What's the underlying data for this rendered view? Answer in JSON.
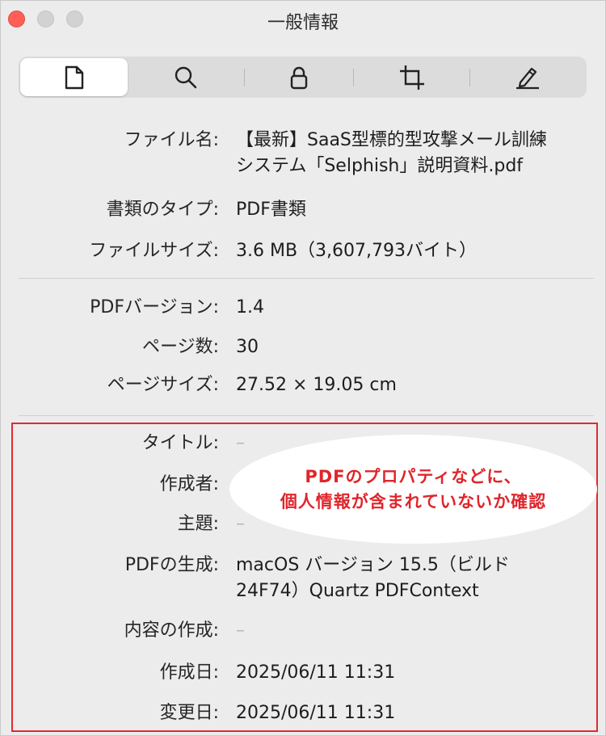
{
  "window": {
    "title": "一般情報"
  },
  "toolbar": {
    "tabs": [
      {
        "name": "document",
        "icon": "document-icon",
        "selected": true
      },
      {
        "name": "search",
        "icon": "search-icon",
        "selected": false
      },
      {
        "name": "security",
        "icon": "lock-icon",
        "selected": false
      },
      {
        "name": "crop",
        "icon": "crop-icon",
        "selected": false
      },
      {
        "name": "annotate",
        "icon": "pencil-icon",
        "selected": false
      }
    ]
  },
  "info": {
    "file_name_label": "ファイル名:",
    "file_name_line1": "【最新】SaaS型標的型攻撃メール訓練",
    "file_name_line2": "システム「Selphish」説明資料.pdf",
    "doc_type_label": "書類のタイプ:",
    "doc_type_value": "PDF書類",
    "file_size_label": "ファイルサイズ:",
    "file_size_value": "3.6 MB（3,607,793バイト）",
    "pdf_version_label": "PDFバージョン:",
    "pdf_version_value": "1.4",
    "page_count_label": "ページ数:",
    "page_count_value": "30",
    "page_size_label": "ページサイズ:",
    "page_size_value": "27.52 × 19.05 cm",
    "title_label": "タイトル:",
    "title_value": "–",
    "author_label": "作成者:",
    "subject_label": "主題:",
    "subject_value": "–",
    "producer_label": "PDFの生成:",
    "producer_line1": "macOS バージョン 15.5（ビルド",
    "producer_line2": "24F74）Quartz PDFContext",
    "creator_label": "内容の作成:",
    "creator_value": "–",
    "created_label": "作成日:",
    "created_value": "2025/06/11 11:31",
    "modified_label": "変更日:",
    "modified_value": "2025/06/11 11:31"
  },
  "annotation": {
    "line1": "PDFのプロパティなどに、",
    "line2": "個人情報が含まれていないか確認",
    "color": "#e0252b"
  }
}
